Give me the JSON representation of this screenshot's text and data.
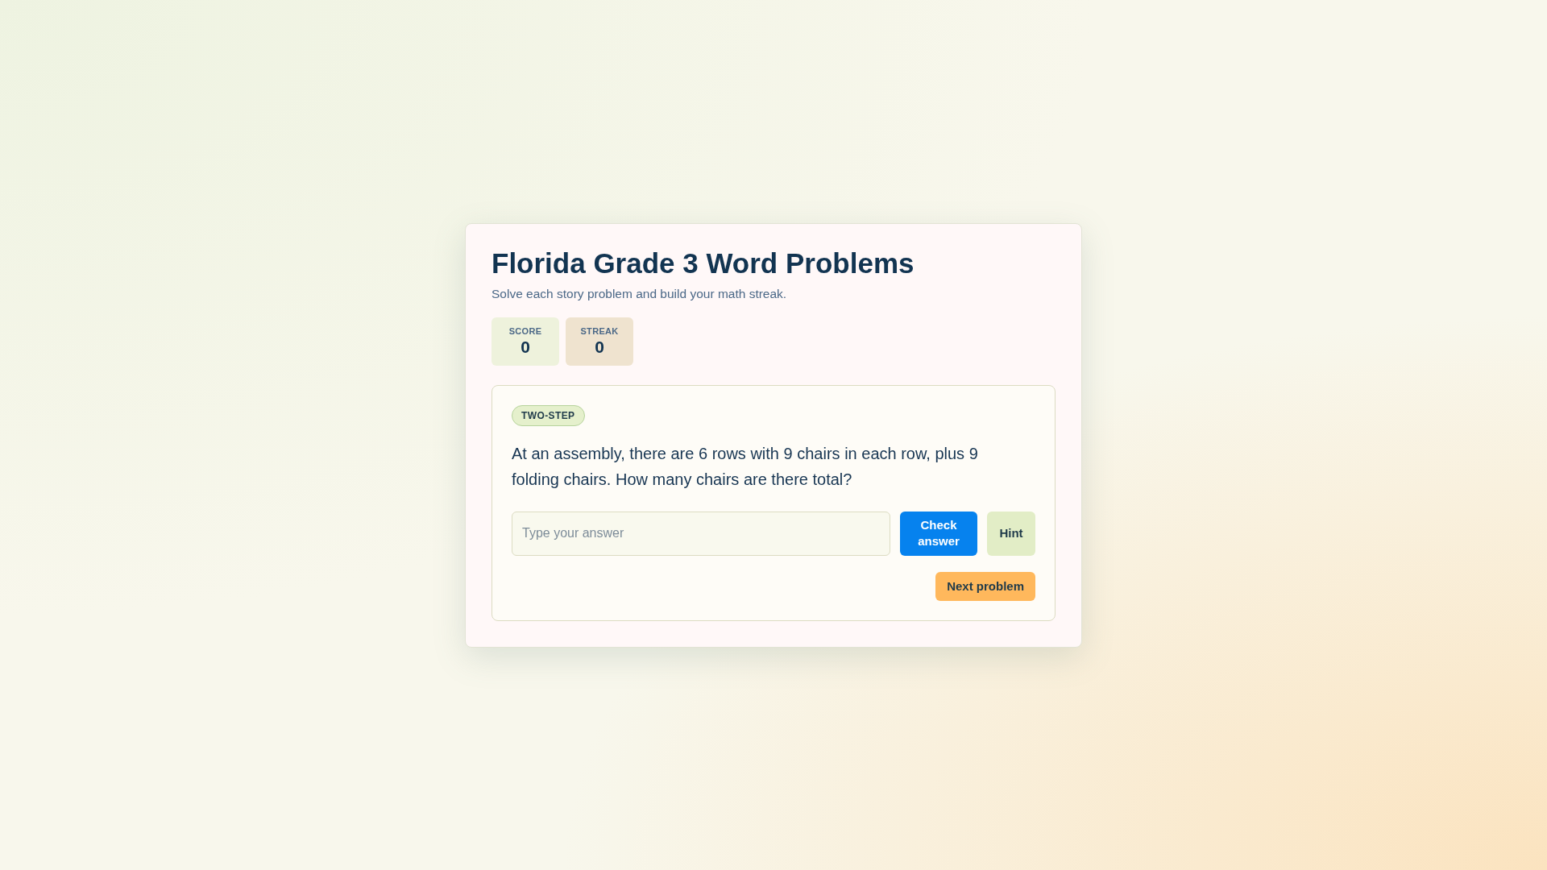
{
  "header": {
    "title": "Florida Grade 3 Word Problems",
    "subtitle": "Solve each story problem and build your math streak."
  },
  "stats": [
    {
      "label": "SCORE",
      "value": "0"
    },
    {
      "label": "STREAK",
      "value": "0"
    }
  ],
  "problem": {
    "tag": "TWO-STEP",
    "question": "At an assembly, there are 6 rows with 9 chairs in each row, plus 9 folding chairs. How many chairs are there total?",
    "answer": {
      "placeholder": "Type your answer"
    },
    "buttons": [
      {
        "kind": "primary",
        "label": "Check answer"
      },
      {
        "kind": "secondary",
        "label": "Hint"
      }
    ],
    "next_button": {
      "label": "Next problem"
    }
  }
}
